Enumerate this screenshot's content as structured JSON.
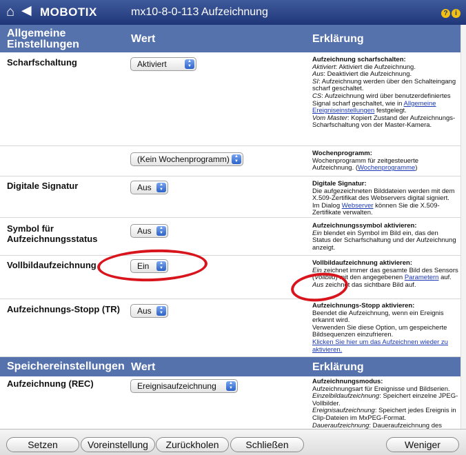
{
  "header": {
    "brand": "MOBOTIX",
    "title": "mx10-8-0-113 Aufzeichnung",
    "home_glyph": "⌂",
    "back_glyph": "◆"
  },
  "general": {
    "title_line1": "Allgemeine",
    "title_line2": "Einstellungen",
    "value_col": "Wert",
    "explain_col": "Erklärung"
  },
  "rows": [
    {
      "label": "Scharfschaltung",
      "value": "Aktiviert",
      "exp": {
        "t": "Aufzeichnung scharfschalten",
        "l1a": "Aktiviert",
        "l1b": ": Aktiviert die Aufzeichnung.",
        "l2a": "Aus",
        "l2b": ": Deaktiviert die Aufzeichnung.",
        "l3a": "SI",
        "l3b": ": Aufzeichnung werden über den Schalteingang scharf geschaltet.",
        "l4a": "CS",
        "l4b": ": Aufzeichnung wird über benutzerdefiniertes Signal scharf geschaltet, wie in ",
        "l4link": "Allgemeine Ereigniseinstellungen",
        "l4c": " festgelegt.",
        "l5a": "Vom Master",
        "l5b": ": Kopiert Zustand der Aufzeichnungs-Scharfschaltung von der Master-Kamera."
      }
    },
    {
      "label": "",
      "value": "(Kein Wochenprogramm)",
      "exp": {
        "t": "Wochenprogramm",
        "body": "Wochenprogramm für zeitgesteuerte Aufzeichnung. (",
        "link": "Wochenprogramme",
        "tail": ")"
      }
    },
    {
      "label": "Digitale Signatur",
      "value": "Aus",
      "exp": {
        "t": "Digitale Signatur",
        "body": "Die aufgezeichneten Bilddateien werden mit dem X.509-Zertifikat des Webservers digital signiert. Im Dialog ",
        "link": "Webserver",
        "tail": " können Sie die X.509-Zertifikate verwalten."
      }
    },
    {
      "label_line1": "Symbol für",
      "label_line2": "Aufzeichnungsstatus",
      "value": "Aus",
      "exp": {
        "t": "Aufzeichnungssymbol aktivieren",
        "ia": "Ein",
        "body": " blendet ein Symbol im Bild ein, das den Status der Scharfschaltung und der Aufzeichnung anzeigt."
      }
    },
    {
      "label": "Vollbildaufzeichnung",
      "value": "Ein",
      "exp": {
        "t": "Vollbildaufzeichnung aktivieren",
        "ia": "Ein",
        "b1": " zeichnet immer das gesamte Bild des Sensors (",
        "ib": "Vollbild",
        "b2": ") mit den angegebenen ",
        "link": "Parametern",
        "b3": " auf. ",
        "ic": "Aus",
        "b4": " zeichnet das sichtbare Bild auf."
      }
    },
    {
      "label": "Aufzeichnungs-Stopp (TR)",
      "value": "Aus",
      "exp": {
        "t": "Aufzeichnungs-Stopp aktivieren",
        "body1": "Beendet die Aufzeichnung, wenn ein Ereignis erkannt wird.",
        "body2": "Verwenden Sie diese Option, um gespeicherte Bildsequenzen einzufrieren.",
        "link": "Klicken Sie hier um das Aufzeichnen wieder zu aktivieren."
      }
    }
  ],
  "storage": {
    "title": "Speichereinstellungen",
    "value_col": "Wert",
    "explain_col": "Erklärung"
  },
  "rec": {
    "label": "Aufzeichnung (REC)",
    "value": "Ereignisaufzeichnung",
    "exp": {
      "t": "Aufzeichnungsmodus",
      "body": "Aufzeichnungsart für Ereignisse und Bildserien.",
      "i1": "Einzelbildaufzeichnung",
      "b1": ": Speichert einzelne JPEG-Vollbilder.",
      "i2": "Ereignisaufzeichnung",
      "b2": ": Speichert jedes Ereignis in Clip-Dateien im MxPEG-Format.",
      "i3": "Daueraufzeichnung",
      "b3": ": Daueraufzeichnung des Videostreams im MxPEG-Format."
    }
  },
  "footer": {
    "set": "Setzen",
    "default": "Voreinstellung",
    "restore": "Zurückholen",
    "close": "Schließen",
    "less": "Weniger"
  },
  "colors": {
    "header": "#1f3778",
    "section": "#5672ad",
    "link": "#1a37b5",
    "highlight_circle": "#d8151d"
  }
}
